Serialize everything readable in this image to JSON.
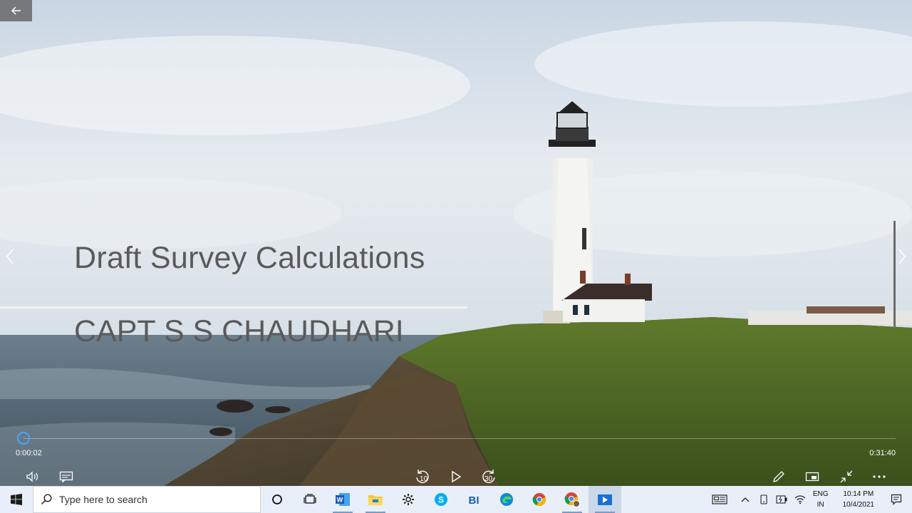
{
  "slide": {
    "title": "Draft Survey Calculations",
    "subtitle": "CAPT S S CHAUDHARI"
  },
  "player": {
    "current_time": "0:00:02",
    "total_time": "0:31:40",
    "progress_fraction": 0.001,
    "skip_back_seconds": "10",
    "skip_forward_seconds": "30"
  },
  "taskbar": {
    "search_placeholder": "Type here to search",
    "language_line1": "ENG",
    "language_line2": "IN",
    "time": "10:14 PM",
    "date": "10/4/2021",
    "icons": [
      "windows-start-icon",
      "search-icon",
      "cortana-icon",
      "task-view-icon",
      "word-icon",
      "file-explorer-icon",
      "settings-icon",
      "skype-icon",
      "bi-icon",
      "edge-icon",
      "chrome-icon",
      "chrome-profile-icon",
      "media-player-icon"
    ]
  },
  "colors": {
    "accent": "#4aa3ff",
    "taskbar_bg": "#e8eff8",
    "title_text": "#5a5a5a"
  }
}
